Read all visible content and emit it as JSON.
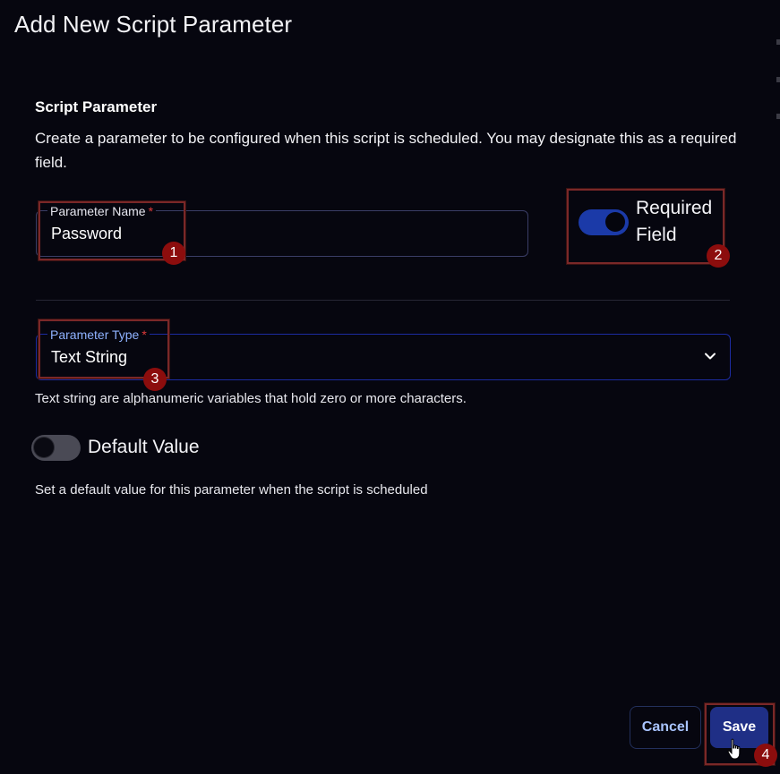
{
  "dialog": {
    "title": "Add New Script Parameter"
  },
  "section": {
    "heading": "Script Parameter",
    "description": "Create a parameter to be configured when this script is scheduled. You may designate this as a required field."
  },
  "parameter_name": {
    "label": "Parameter Name",
    "required_mark": "*",
    "value": "Password"
  },
  "required_field": {
    "label_line1": "Required",
    "label_line2": "Field",
    "enabled": true
  },
  "parameter_type": {
    "label": "Parameter Type",
    "required_mark": "*",
    "selected": "Text String",
    "helper": "Text string are alphanumeric variables that hold zero or more characters."
  },
  "default_value": {
    "label": "Default Value",
    "enabled": false,
    "helper": "Set a default value for this parameter when the script is scheduled"
  },
  "buttons": {
    "cancel": "Cancel",
    "save": "Save"
  },
  "annotations": {
    "step1": "1",
    "step2": "2",
    "step3": "3",
    "step4": "4"
  },
  "colors": {
    "background": "#06060f",
    "accent": "#1f2f86",
    "toggle_on": "#1b3aa8",
    "toggle_off": "#4a4a55",
    "annotation": "#8c0d0d"
  },
  "icons": {
    "dropdown": "chevron-down-icon",
    "cursor": "hand-pointer-icon"
  }
}
